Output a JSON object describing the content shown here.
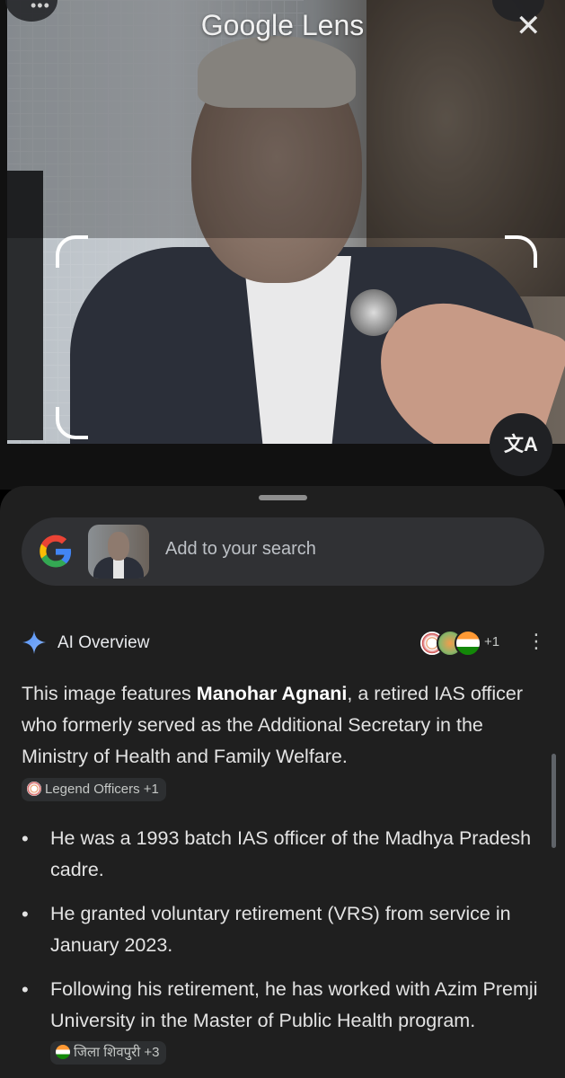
{
  "app": {
    "title": "Google Lens"
  },
  "top_bar": {
    "more_glyph": "•••",
    "close_glyph": "✕"
  },
  "translate_button": {
    "glyph": "文A"
  },
  "search": {
    "placeholder": "Add to your search"
  },
  "ai_overview": {
    "label": "AI Overview",
    "sources_more": "+1",
    "menu_glyph": "⋮",
    "summary": {
      "before": "This image features ",
      "name": "Manohar Agnani",
      "after": ", a retired IAS officer who formerly served as the Additional Secretary in the Ministry of Health and Family Welfare."
    },
    "summary_chip": "Legend Officers +1",
    "bullets": [
      {
        "text": "He was a 1993 batch IAS officer of the Madhya Pradesh cadre."
      },
      {
        "text": "He granted voluntary retirement (VRS) from service in January 2023."
      },
      {
        "text": "Following his retirement, he has worked with Azim Premji University in the Master of Public Health program.",
        "chip": "जिला शिवपुरी +3"
      }
    ]
  },
  "icons": [
    "more-icon",
    "close-icon",
    "translate-icon",
    "google-g-icon",
    "sparkle-icon",
    "kebab-menu-icon"
  ]
}
